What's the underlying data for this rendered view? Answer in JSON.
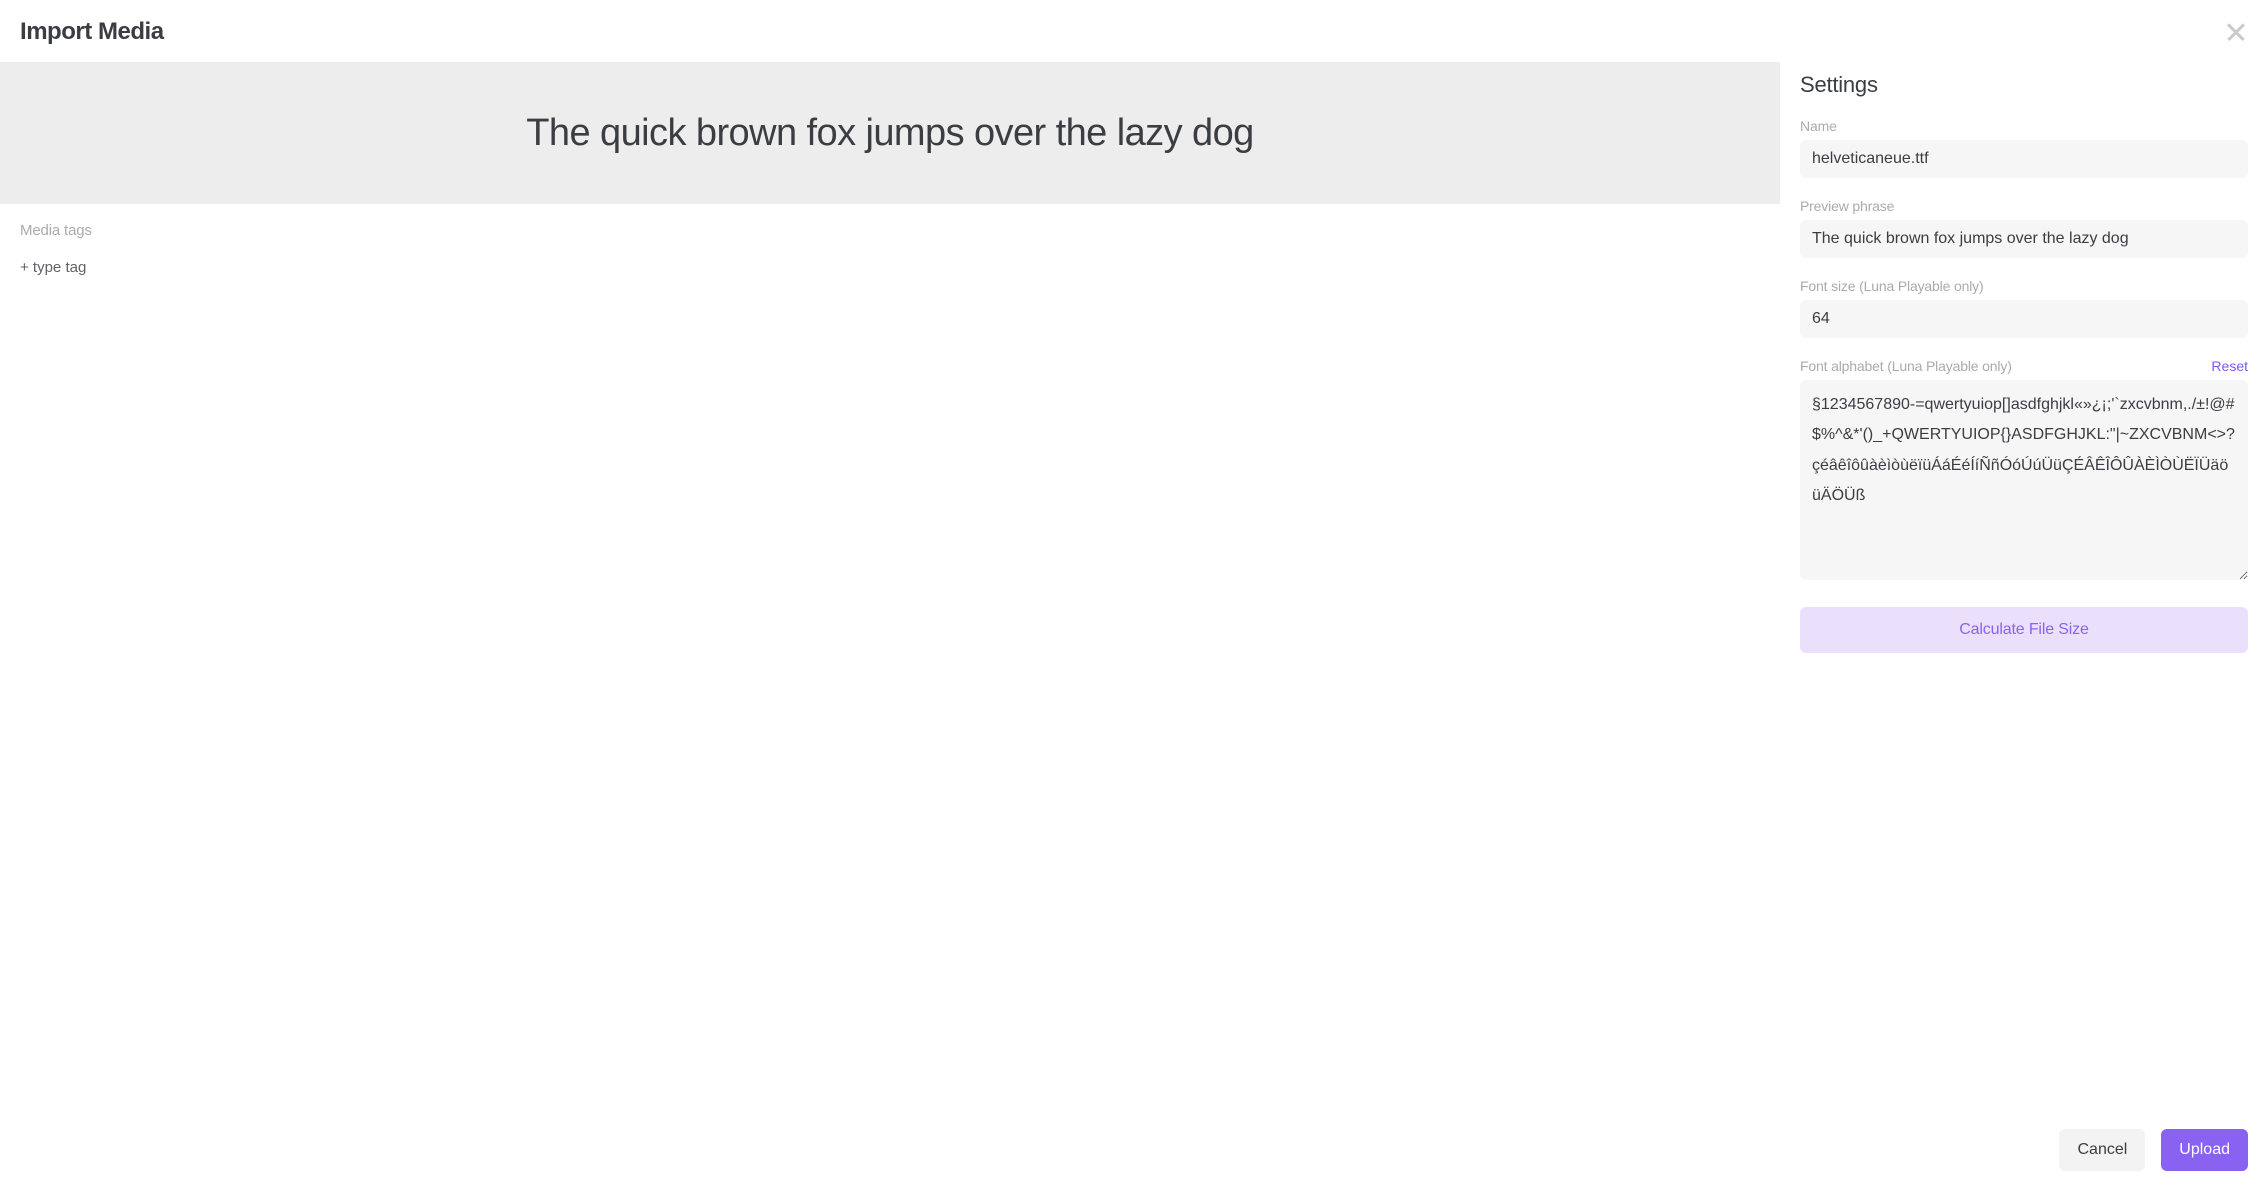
{
  "header": {
    "title": "Import Media"
  },
  "preview": {
    "text": "The quick brown fox jumps over the lazy dog"
  },
  "tags": {
    "label": "Media tags",
    "add": "+ type tag"
  },
  "settings": {
    "title": "Settings",
    "name": {
      "label": "Name",
      "value": "helveticaneue.ttf"
    },
    "preview_phrase": {
      "label": "Preview phrase",
      "value": "The quick brown fox jumps over the lazy dog"
    },
    "font_size": {
      "label": "Font size (Luna Playable only)",
      "value": "64"
    },
    "font_alphabet": {
      "label": "Font alphabet (Luna Playable only)",
      "reset": "Reset",
      "value": "§1234567890-=qwertyuiop[]asdfghjkl«»¿¡;'`zxcvbnm,./±!@#$%^&*'()_+QWERTYUIOP{}ASDFGHJKL:\"|~ZXCVBNM<>?\nçéâêîôûàèìòùëïüÁáÉéÍíÑñÓóÚúÜüÇÉÂÊÎÔÛÀÈÌÒÙËÏÜäöüÄÖÜß"
    },
    "calculate": "Calculate File Size"
  },
  "footer": {
    "cancel": "Cancel",
    "upload": "Upload"
  }
}
